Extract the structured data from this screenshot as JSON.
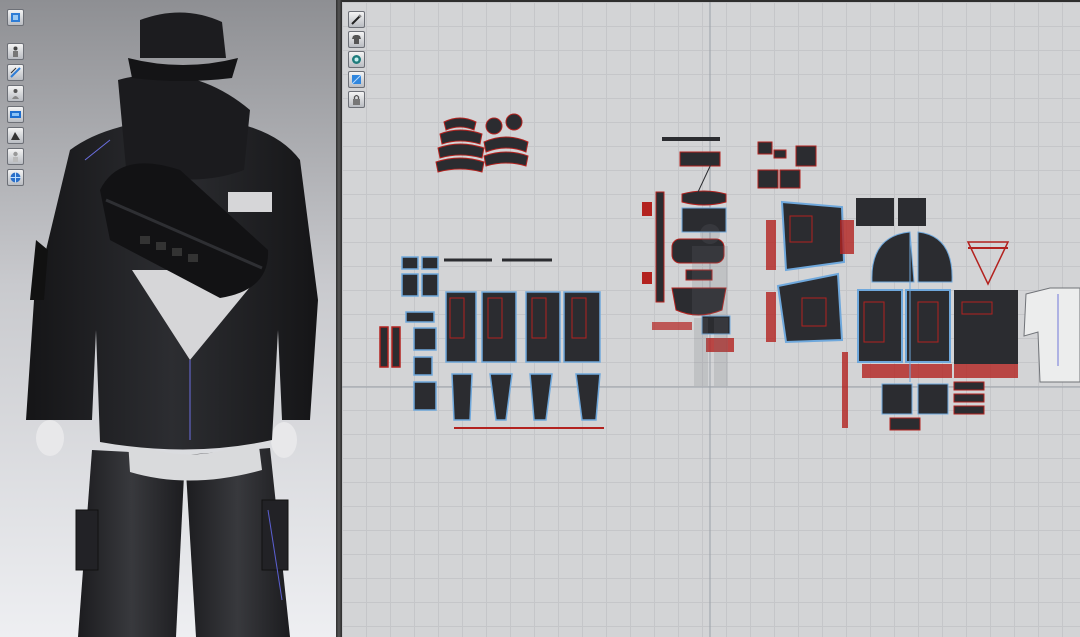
{
  "window": {
    "left_panel": "3d-garment-view",
    "right_panel": "2d-pattern-window"
  },
  "toolbar_3d": {
    "icons": [
      "fabric-display-icon",
      "avatar-display-icon",
      "stitch-display-icon",
      "measure-display-icon",
      "texture-display-icon",
      "shading-display-icon",
      "avatar-hide-icon",
      "globe-render-icon"
    ]
  },
  "toolbar_2d": {
    "icons": [
      "pattern-pen-icon",
      "garment-display-icon",
      "grade-icon",
      "sheet-display-icon",
      "lock-icon"
    ]
  },
  "colors": {
    "grid_bg": "#d3d4d6",
    "piece_fill": "#2b2c30",
    "piece_outline_selected": "#6fa8dc",
    "seam_line": "#b3221f",
    "axis": "#9aa0a8",
    "panel_3d_bg_top": "#8e8f93",
    "panel_3d_bg_bottom": "#eeeff2"
  },
  "garment": {
    "items": [
      "bucket-hat",
      "hooded-jacket",
      "sling-bag",
      "cargo-pants",
      "t-shirt"
    ]
  }
}
